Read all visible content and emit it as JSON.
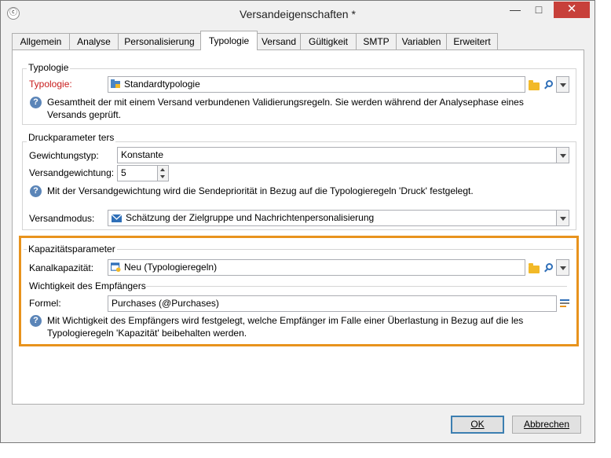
{
  "window": {
    "title": "Versandeigenschaften *",
    "minimize_glyph": "—",
    "maximize_glyph": "□",
    "close_glyph": "✕"
  },
  "tabs": [
    {
      "label": "Allgemein"
    },
    {
      "label": "Analyse"
    },
    {
      "label": "Personalisierung"
    },
    {
      "label": "Typologie",
      "active": true
    },
    {
      "label": "Versand"
    },
    {
      "label": "Gültigkeit"
    },
    {
      "label": "SMTP"
    },
    {
      "label": "Variablen"
    },
    {
      "label": "Erweitert"
    }
  ],
  "typology_group": {
    "title": "Typologie",
    "label": "Typologie:",
    "value": "Standardtypologie",
    "help": "Gesamtheit der mit einem Versand verbundenen Validierungsregeln. Sie werden während der Analysephase eines",
    "help_line2": "Versands geprüft."
  },
  "print_group": {
    "title": "Druckparameter ters",
    "weighting_type_label": "Gewichtungstyp:",
    "weighting_type_value": "Konstante",
    "weight_label": "Versandgewichtung:",
    "weight_value": "5",
    "help": "Mit der Versandgewichtung wird die Sendepriorität in Bezug auf die Typologieregeln 'Druck' festgelegt.",
    "mode_label": "Versandmodus:",
    "mode_value": "Schätzung der Zielgruppe und Nachrichtenpersonalisierung"
  },
  "capacity_group": {
    "title": "Kapazitätsparameter",
    "channel_label": "Kanalkapazität:",
    "channel_value": "Neu (Typologieregeln)",
    "importance_title": "Wichtigkeit des Empfängers",
    "formula_label": "Formel:",
    "formula_value": "Purchases (@Purchases)",
    "help": "Mit Wichtigkeit des Empfängers wird festgelegt, welche Empfänger im Falle einer Überlastung in Bezug auf die les",
    "help_line2": "Typologieregeln 'Kapazität' beibehalten werden."
  },
  "buttons": {
    "ok": "OK",
    "cancel": "Abbrechen"
  },
  "colors": {
    "highlight": "#e8931d",
    "required_label": "#c81b1b",
    "help_icon": "#5b85b8"
  },
  "help_glyph": "?"
}
